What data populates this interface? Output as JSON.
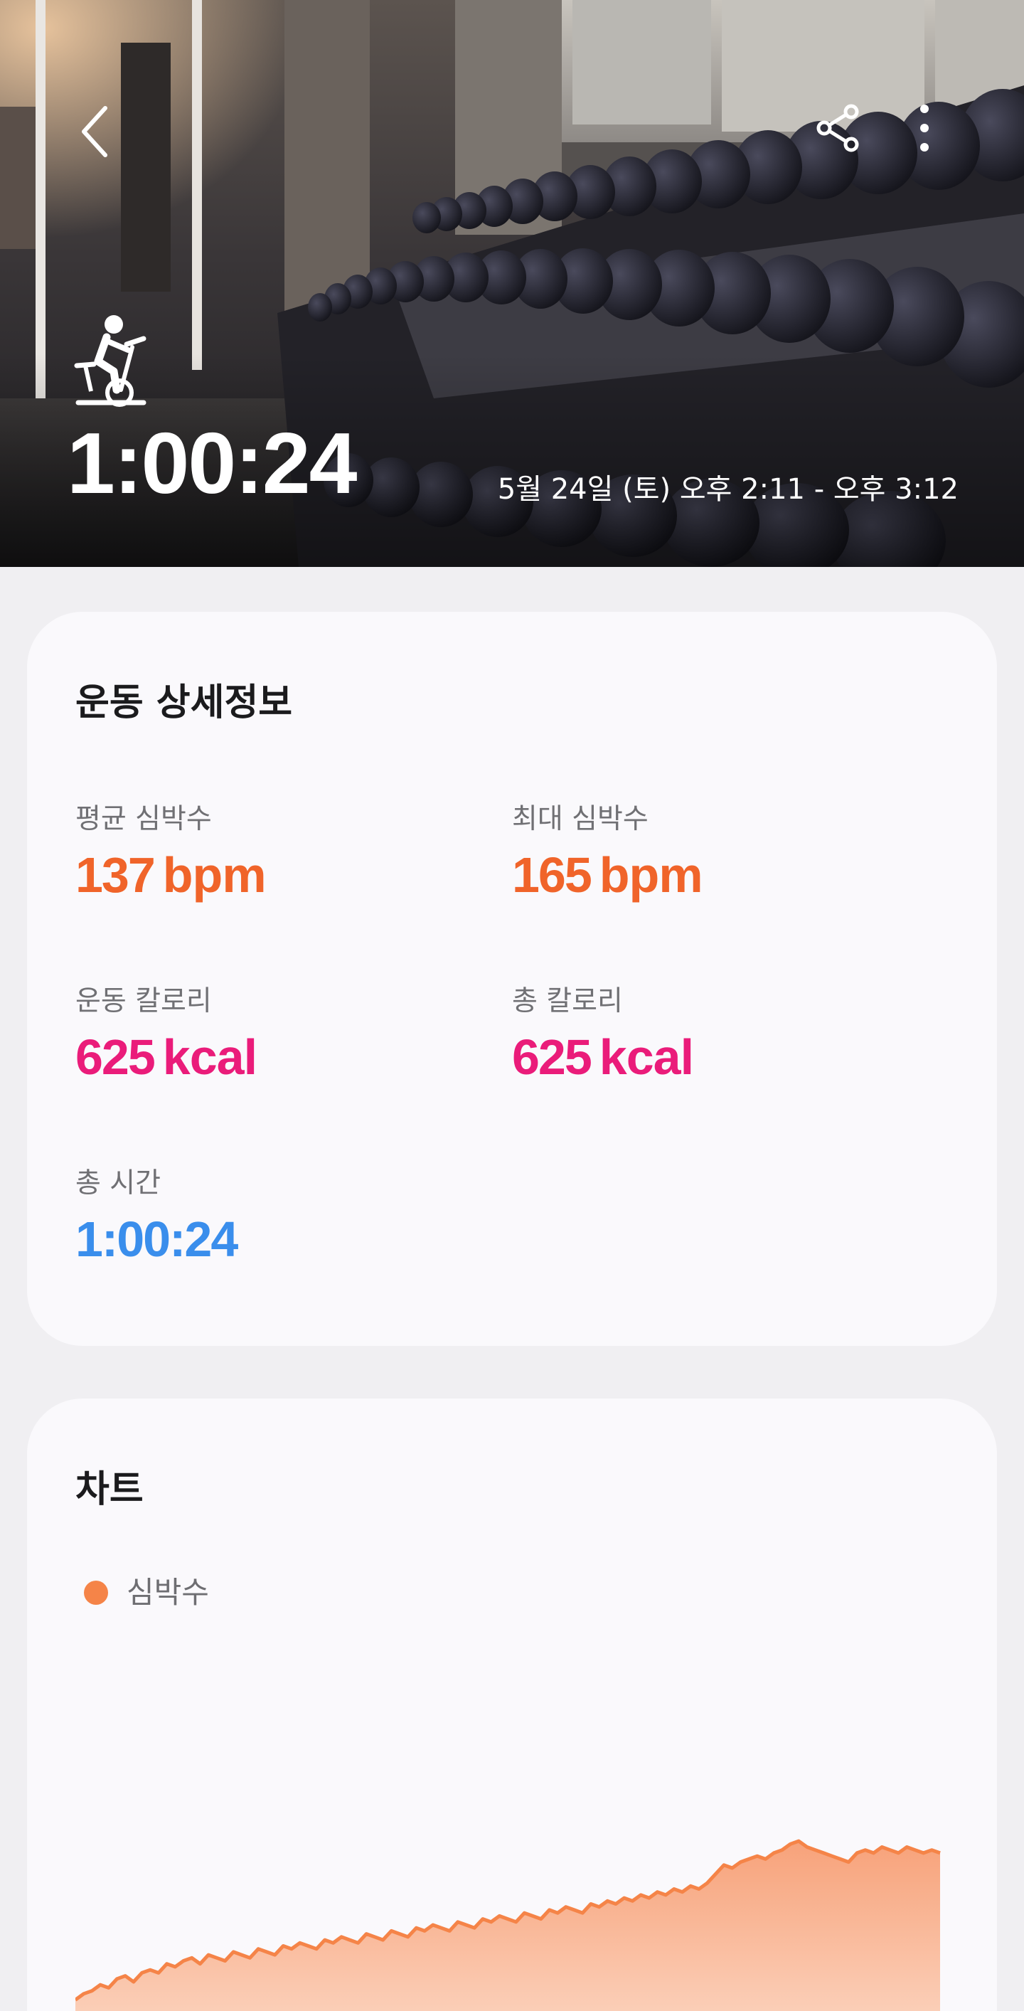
{
  "hero": {
    "duration": "1:00:24",
    "datetime": "5월 24일 (토) 오후 2:11 - 오후 3:12"
  },
  "details": {
    "title": "운동 상세정보",
    "stats": [
      {
        "label": "평균 심박수",
        "value": "137",
        "unit": "bpm",
        "color": "#f0642a"
      },
      {
        "label": "최대 심박수",
        "value": "165",
        "unit": "bpm",
        "color": "#f0642a"
      },
      {
        "label": "운동 칼로리",
        "value": "625",
        "unit": "kcal",
        "color": "#ea1c7a"
      },
      {
        "label": "총 칼로리",
        "value": "625",
        "unit": "kcal",
        "color": "#ea1c7a"
      },
      {
        "label": "총 시간",
        "value": "1:00:24",
        "unit": "",
        "color": "#3a8eec"
      }
    ]
  },
  "chart": {
    "title": "차트",
    "legend": "심박수",
    "accent": "#f58448"
  },
  "chart_data": {
    "type": "area",
    "title": "",
    "series": [
      {
        "name": "심박수",
        "values": [
          103,
          105,
          106,
          108,
          107,
          110,
          111,
          109,
          112,
          113,
          112,
          115,
          114,
          116,
          117,
          115,
          118,
          117,
          116,
          119,
          118,
          117,
          120,
          119,
          118,
          121,
          120,
          122,
          121,
          120,
          123,
          122,
          124,
          123,
          122,
          125,
          124,
          123,
          126,
          125,
          124,
          127,
          126,
          128,
          127,
          126,
          129,
          128,
          127,
          130,
          129,
          131,
          130,
          129,
          132,
          131,
          130,
          133,
          132,
          134,
          133,
          132,
          135,
          134,
          136,
          135,
          137,
          136,
          138,
          137,
          139,
          138,
          140,
          139,
          141,
          140,
          142,
          145,
          148,
          147,
          149,
          150,
          151,
          150,
          152,
          153,
          155,
          156,
          154,
          153,
          152,
          151,
          150,
          149,
          152,
          153,
          152,
          154,
          153,
          152,
          154,
          153,
          152,
          153,
          152
        ]
      }
    ]
  }
}
